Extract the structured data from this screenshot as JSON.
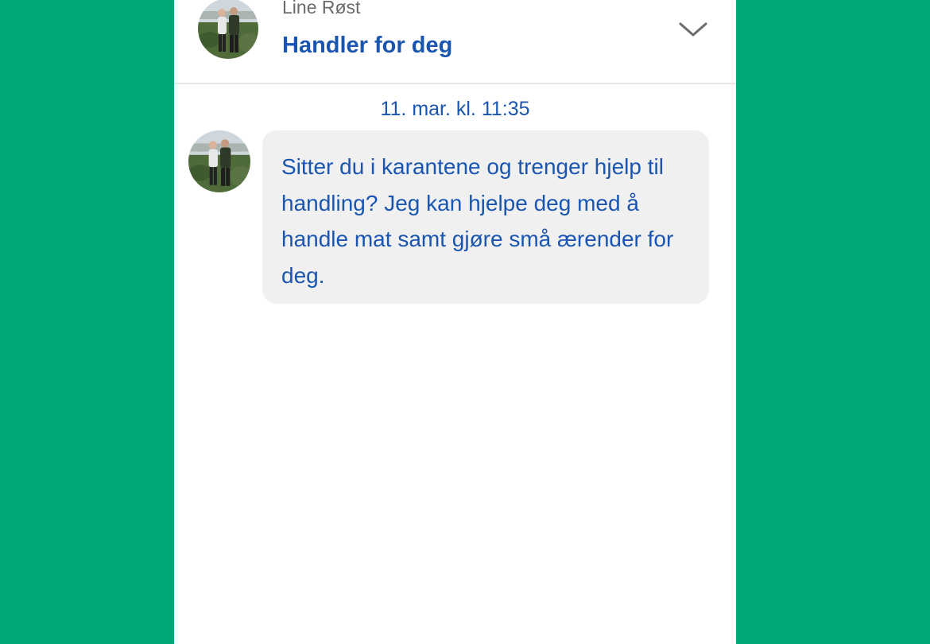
{
  "colors": {
    "background": "#00aa78",
    "panel": "#ffffff",
    "accent_blue": "#1a55b0",
    "muted_text": "#6b6b6b",
    "bubble": "#f0f0f0"
  },
  "header": {
    "sender_name": "Line Røst",
    "subject": "Handler for deg",
    "expand_icon": "chevron-down-icon"
  },
  "conversation": {
    "timestamp": "11. mar. kl. 11:35",
    "messages": [
      {
        "text": "Sitter du i karantene og trenger hjelp til handling? Jeg kan hjelpe deg med å handle mat samt gjøre små ærender for deg."
      }
    ]
  }
}
